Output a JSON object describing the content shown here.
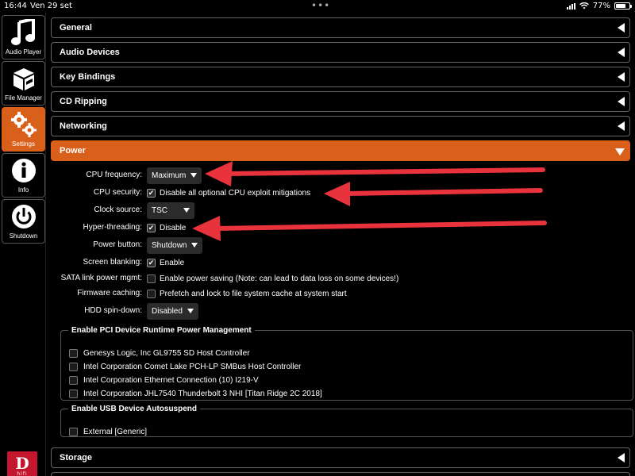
{
  "status_bar": {
    "time": "16:44",
    "date": "Ven 29 set",
    "battery": "77%",
    "battery_level": 0.77
  },
  "sidebar": {
    "items": [
      {
        "label": "Audio Player",
        "icon": "music-note-icon"
      },
      {
        "label": "File Manager",
        "icon": "box-icon"
      },
      {
        "label": "Settings",
        "icon": "gears-icon",
        "active": true
      },
      {
        "label": "Info",
        "icon": "info-icon"
      },
      {
        "label": "Shutdown",
        "icon": "power-icon"
      }
    ],
    "logo_text": "D",
    "logo_subtext": "hifi"
  },
  "sections": {
    "general": "General",
    "audio_devices": "Audio Devices",
    "key_bindings": "Key Bindings",
    "cd_ripping": "CD Ripping",
    "networking": "Networking",
    "power": "Power",
    "storage": "Storage"
  },
  "power": {
    "cpu_frequency": {
      "label": "CPU frequency:",
      "value": "Maximum"
    },
    "cpu_security": {
      "label": "CPU security:",
      "text": "Disable all optional CPU exploit mitigations",
      "checked": true
    },
    "clock_source": {
      "label": "Clock source:",
      "value": "TSC"
    },
    "hyper_threading": {
      "label": "Hyper-threading:",
      "text": "Disable",
      "checked": true
    },
    "power_button": {
      "label": "Power button:",
      "value": "Shutdown"
    },
    "screen_blanking": {
      "label": "Screen blanking:",
      "text": "Enable",
      "checked": true
    },
    "sata_link": {
      "label": "SATA link power mgmt:",
      "text": "Enable power saving (Note: can lead to data loss on some devices!)",
      "checked": false
    },
    "firmware_caching": {
      "label": "Firmware caching:",
      "text": "Prefetch and lock to file system cache at system start",
      "checked": false
    },
    "hdd_spin_down": {
      "label": "HDD spin-down:",
      "value": "Disabled"
    }
  },
  "pci_group": {
    "title": "Enable PCI Device Runtime Power Management",
    "items": [
      "Genesys Logic, Inc GL9755 SD Host Controller",
      "Intel Corporation Comet Lake PCH-LP SMBus Host Controller",
      "Intel Corporation Ethernet Connection (10) I219-V",
      "Intel Corporation JHL7540 Thunderbolt 3 NHI [Titan Ridge 2C 2018]"
    ]
  },
  "usb_group": {
    "title": "Enable USB Device Autosuspend",
    "items": [
      "External [Generic]"
    ]
  },
  "colors": {
    "accent": "#d9601a",
    "annotation_arrow": "#e8323c"
  }
}
